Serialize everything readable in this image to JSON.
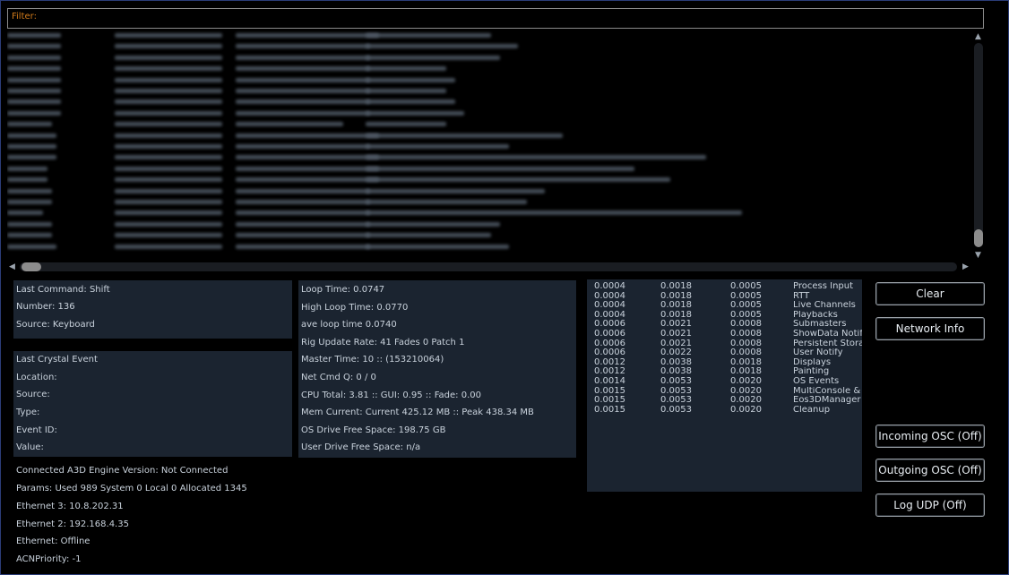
{
  "filter": {
    "label": "Filter:",
    "value": ""
  },
  "left_panel": {
    "last_command": "Last Command: Shift",
    "number": "Number: 136",
    "source": "Source: Keyboard",
    "crystal_header": "Last Crystal Event",
    "location": "Location:",
    "crystal_source": "Source:",
    "type": "Type:",
    "event_id": "Event ID:",
    "value": "Value:"
  },
  "info_lines": [
    "Connected A3D Engine Version: Not Connected",
    "Params: Used 989 System 0 Local 0 Allocated 1345",
    "Ethernet 3: 10.8.202.31",
    "Ethernet 2: 192.168.4.35",
    "Ethernet: Offline",
    "ACNPriority: -1"
  ],
  "stats_panel": [
    "Loop Time:  0.0747",
    "High Loop Time:  0.0770",
    "ave loop time  0.0740",
    "Rig Update Rate: 41 Fades 0 Patch 1",
    "Master Time: 10 :: (153210064)",
    "Net Cmd Q: 0 / 0",
    "CPU Total: 3.81 :: GUI: 0.95 :: Fade: 0.00",
    "Mem Current: Current 425.12 MB :: Peak 438.34 MB",
    "OS Drive Free Space: 198.75 GB",
    "User Drive Free Space: n/a"
  ],
  "timing_table": {
    "rows": [
      [
        "0.0004",
        "0.0018",
        "0.0005",
        "Process Input"
      ],
      [
        "0.0004",
        "0.0018",
        "0.0005",
        "RTT"
      ],
      [
        "0.0004",
        "0.0018",
        "0.0005",
        "Live Channels"
      ],
      [
        "0.0004",
        "0.0018",
        "0.0005",
        "Playbacks"
      ],
      [
        "0.0006",
        "0.0021",
        "0.0008",
        "Submasters"
      ],
      [
        "0.0006",
        "0.0021",
        "0.0008",
        "ShowData Notify"
      ],
      [
        "0.0006",
        "0.0021",
        "0.0008",
        "Persistent Stora"
      ],
      [
        "0.0006",
        "0.0022",
        "0.0008",
        "User Notify"
      ],
      [
        "0.0012",
        "0.0038",
        "0.0018",
        "Displays"
      ],
      [
        "0.0012",
        "0.0038",
        "0.0018",
        "Painting"
      ],
      [
        "0.0014",
        "0.0053",
        "0.0020",
        "OS Events"
      ],
      [
        "0.0015",
        "0.0053",
        "0.0020",
        "MultiConsole & I"
      ],
      [
        "0.0015",
        "0.0053",
        "0.0020",
        "Eos3DManager"
      ],
      [
        "0.0015",
        "0.0053",
        "0.0020",
        "Cleanup"
      ]
    ]
  },
  "buttons": {
    "clear": "Clear",
    "network_info": "Network Info",
    "incoming_osc": "Incoming OSC (Off)",
    "outgoing_osc": "Outgoing OSC (Off)",
    "log_udp": "Log UDP (Off)"
  },
  "icons": {
    "scroll_up": "scroll-up-arrow-icon",
    "scroll_down": "scroll-down-arrow-icon",
    "scroll_left": "scroll-left-arrow-icon",
    "scroll_right": "scroll-right-arrow-icon"
  },
  "colors": {
    "filter_label": "#d07a1a",
    "panel_bg": "#1b2430",
    "frame_border": "#2b3d78"
  }
}
